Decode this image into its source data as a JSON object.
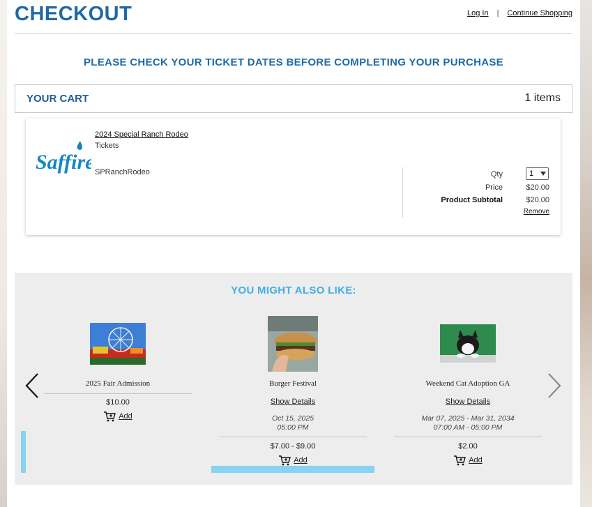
{
  "header": {
    "title": "CHECKOUT",
    "login_label": "Log In",
    "separator": "|",
    "continue_label": "Continue Shopping"
  },
  "notice": "PLEASE CHECK YOUR TICKET DATES BEFORE COMPLETING YOUR PURCHASE",
  "cart": {
    "title": "YOUR CART",
    "count_label": "1 items",
    "item": {
      "brand_logo_text": "Saffire",
      "name": "2024 Special Ranch Rodeo",
      "type": "Tickets",
      "sku": "SPRanchRodeo",
      "qty_label": "Qty",
      "qty_value": "1",
      "price_label": "Price",
      "price_value": "$20.00",
      "subtotal_label": "Product Subtotal",
      "subtotal_value": "$20.00",
      "remove_label": "Remove"
    }
  },
  "recommendations": {
    "title": "YOU MIGHT ALSO LIKE:",
    "items": [
      {
        "name": "2025 Fair Admission",
        "price": "$10.00",
        "add_label": "Add"
      },
      {
        "name": "Burger Festival",
        "details_label": "Show Details",
        "date": "Oct 15, 2025",
        "time": "05:00 PM",
        "price": "$7.00 - $9.00",
        "add_label": "Add"
      },
      {
        "name": "Weekend Cat Adoption GA",
        "details_label": "Show Details",
        "date": "Mar 07, 2025 - Mar 31, 2034",
        "time": "07:00 AM - 05:00 PM",
        "price": "$2.00",
        "add_label": "Add"
      }
    ]
  },
  "colors": {
    "primary_blue": "#1f6aa5",
    "light_blue": "#41aee8",
    "accent_bar": "#86d3f2",
    "panel_gray": "#ededed"
  }
}
